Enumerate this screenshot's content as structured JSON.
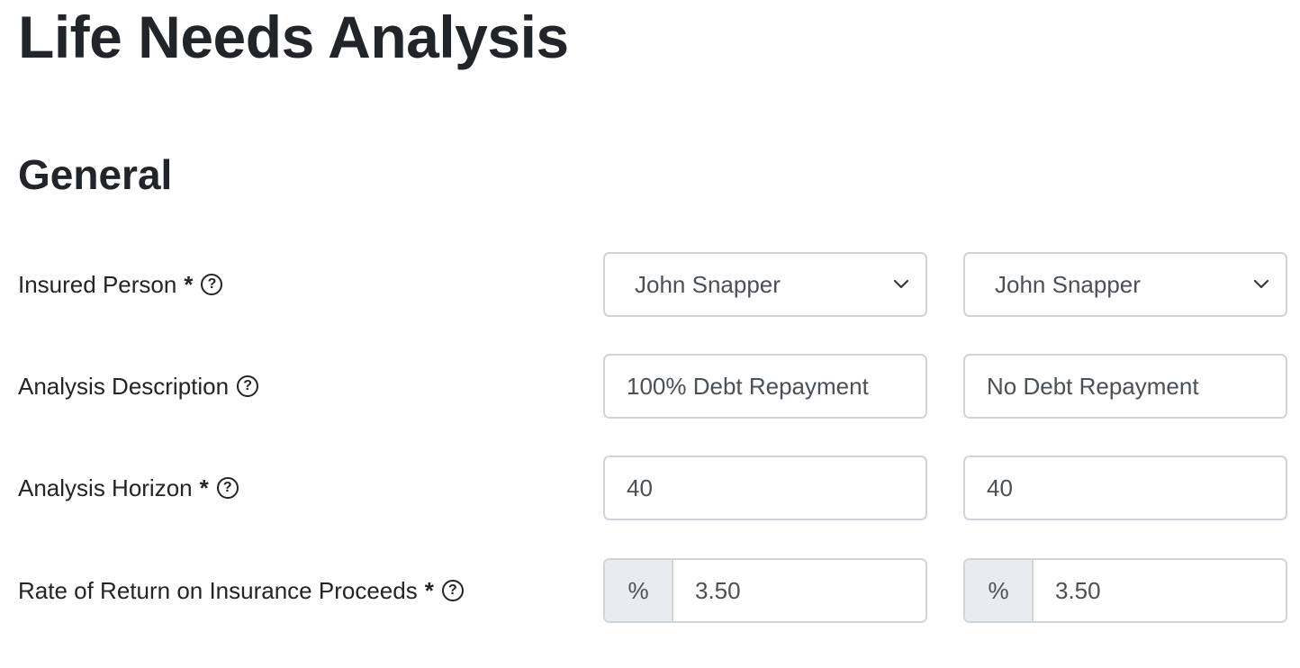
{
  "page": {
    "title": "Life Needs Analysis"
  },
  "section": {
    "title": "General"
  },
  "fields": {
    "insured_person": {
      "label": "Insured Person",
      "required_mark": "*",
      "help": "?",
      "value_a": "John Snapper",
      "value_b": "John Snapper"
    },
    "analysis_description": {
      "label": "Analysis Description",
      "help": "?",
      "value_a": "100% Debt Repayment",
      "value_b": "No Debt Repayment"
    },
    "analysis_horizon": {
      "label": "Analysis Horizon",
      "required_mark": "*",
      "help": "?",
      "value_a": "40",
      "value_b": "40"
    },
    "rate_of_return": {
      "label": "Rate of Return on Insurance Proceeds",
      "required_mark": "*",
      "help": "?",
      "addon": "%",
      "value_a": "3.50",
      "value_b": "3.50"
    }
  },
  "icons": {
    "help": "question-circle-icon",
    "dropdown": "chevron-down-icon"
  },
  "colors": {
    "text": "#212529",
    "input_text": "#495057",
    "border": "#ced4da",
    "addon_bg": "#e9ecef"
  }
}
